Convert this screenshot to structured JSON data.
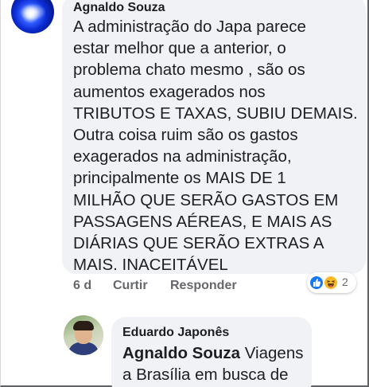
{
  "comment": {
    "author": "Agnaldo Souza",
    "text": "A administração do Japa parece\nestar melhor que a anterior, o\nproblema chato mesmo , são os\naumentos exagerados nos\nTRIBUTOS E TAXAS, SUBIU DEMAIS.\nOutra coisa ruim são os gastos\nexagerados na administração,\nprincipalmente os MAIS DE 1\nMILHÃO QUE SERÃO GASTOS EM\nPASSAGENS AÉREAS, E MAIS AS\nDIÁRIAS QUE SERÃO EXTRAS A\nMAIS. INACEITÁVEL",
    "time": "6 d",
    "like_label": "Curtir",
    "reply_label": "Responder",
    "reaction_count": "2",
    "reaction_icons": [
      "like-icon",
      "haha-icon"
    ]
  },
  "reply": {
    "author": "Eduardo Japonês",
    "mention": "Agnaldo Souza",
    "text_first": " Viagens",
    "text_rest": "a Brasília em busca de"
  },
  "colors": {
    "bubble": "#f0f2f5",
    "meta_text": "#65676b",
    "like_blue": "#1877f2",
    "haha_yellow": "#f7b928"
  }
}
